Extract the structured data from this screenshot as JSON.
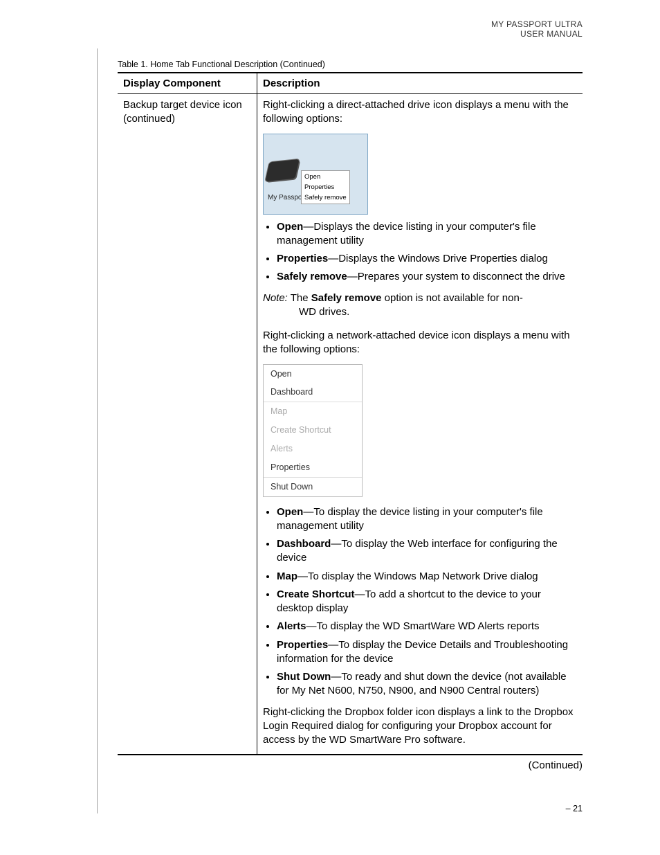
{
  "header": {
    "product": "MY PASSPORT ULTRA",
    "doc": "USER MANUAL"
  },
  "caption": "Table 1.  Home Tab Functional Description (Continued)",
  "th1": "Display Component",
  "th2": "Description",
  "col1": "Backup target device icon (continued)",
  "p1": "Right-clicking a direct-attached drive icon displays a menu with the following options:",
  "mini1": {
    "label": "My Passpo",
    "m1": "Open",
    "m2": "Properties",
    "m3": "Safely remove"
  },
  "b1": {
    "t": "Open",
    "d": "—Displays the device listing in your computer's file management utility"
  },
  "b2": {
    "t": "Properties",
    "d": "—Displays the Windows Drive Properties dialog"
  },
  "b3": {
    "t": "Safely remove",
    "d": "—Prepares your system to disconnect the drive"
  },
  "note": {
    "lbl": "Note:",
    "pre": "The ",
    "bold": "Safely remove",
    "post": " option is not available for non-",
    "line2": "WD drives."
  },
  "p2": "Right-clicking a network-attached device icon displays a menu with the following options:",
  "mini2": {
    "a": "Open",
    "b": "Dashboard",
    "c": "Map",
    "d": "Create Shortcut",
    "e": "Alerts",
    "f": "Properties",
    "g": "Shut Down"
  },
  "c1": {
    "t": "Open",
    "d": "—To display the device listing in your computer's file management utility"
  },
  "c2": {
    "t": "Dashboard",
    "d": "—To display the Web interface for configuring the device"
  },
  "c3": {
    "t": "Map",
    "d": "—To display the Windows Map Network Drive dialog"
  },
  "c4": {
    "t": "Create Shortcut",
    "d": "—To add a shortcut to the device to your desktop display"
  },
  "c5": {
    "t": "Alerts",
    "d": "—To display the WD SmartWare WD Alerts reports"
  },
  "c6": {
    "t": "Properties",
    "d": "—To display the Device Details and Troubleshooting information for the device"
  },
  "c7": {
    "t": "Shut Down",
    "d": "—To ready and shut down the device (not available for My Net N600, N750, N900, and N900 Central routers)"
  },
  "p3": "Right-clicking the Dropbox folder icon displays a link to the Dropbox Login Required dialog for configuring your Dropbox account for access by the WD SmartWare Pro software.",
  "continued": "(Continued)",
  "pagefoot": "– 21"
}
